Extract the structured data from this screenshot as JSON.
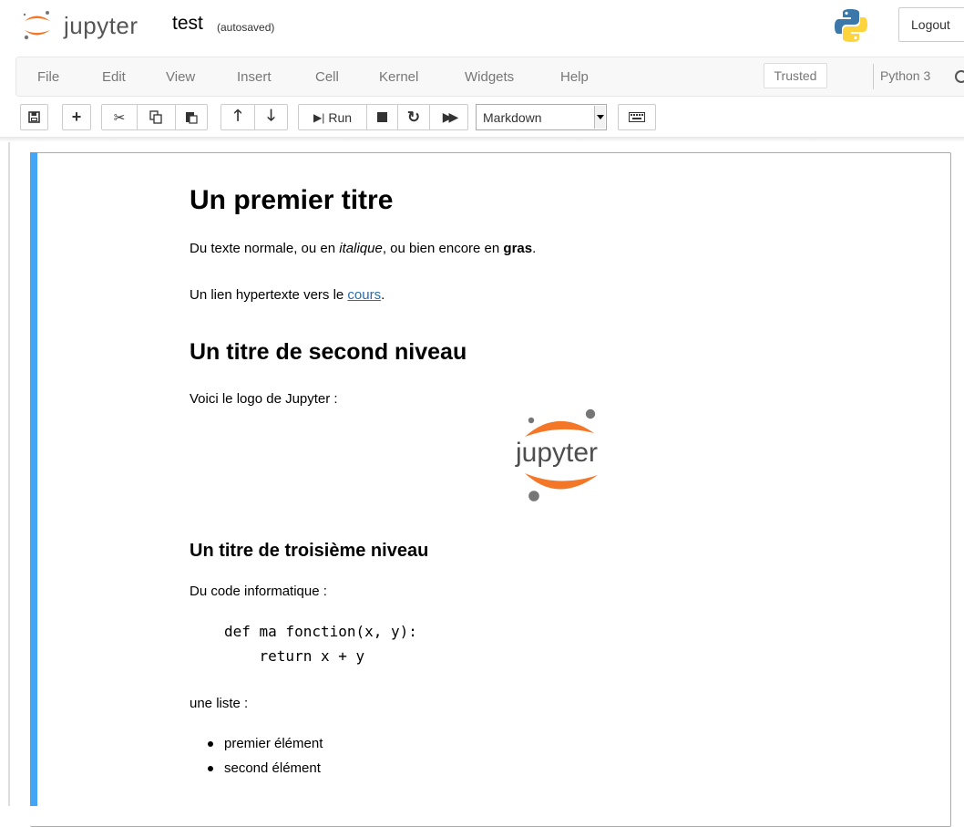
{
  "header": {
    "logo_text": "jupyter",
    "notebook_name": "test",
    "autosave_status": "(autosaved)",
    "logout_label": "Logout"
  },
  "menubar": {
    "items": [
      "File",
      "Edit",
      "View",
      "Insert",
      "Cell",
      "Kernel",
      "Widgets",
      "Help"
    ],
    "trusted_label": "Trusted",
    "kernel_name": "Python 3"
  },
  "toolbar": {
    "run_label": "Run",
    "cell_type": "Markdown"
  },
  "cell": {
    "h1": "Un premier titre",
    "p1_a": "Du texte normale, ou en ",
    "p1_italic": "italique",
    "p1_b": ", ou bien encore en ",
    "p1_bold": "gras",
    "p1_c": ".",
    "p2_a": "Un lien hypertexte vers le ",
    "p2_link": "cours",
    "p2_b": ".",
    "h2": "Un titre de second niveau",
    "p3": "Voici le logo de Jupyter :",
    "image_logo_text": "jupyter",
    "h3": "Un titre de troisième niveau",
    "p4": "Du code informatique :",
    "code_line1": "def ma fonction(x, y):",
    "code_line2": "    return x + y",
    "p5": "une liste :",
    "list_items": [
      "premier élément",
      "second élément"
    ]
  },
  "colors": {
    "accent_blue": "#42a5f5",
    "jupyter_orange": "#f37726",
    "link": "#296eaa"
  }
}
